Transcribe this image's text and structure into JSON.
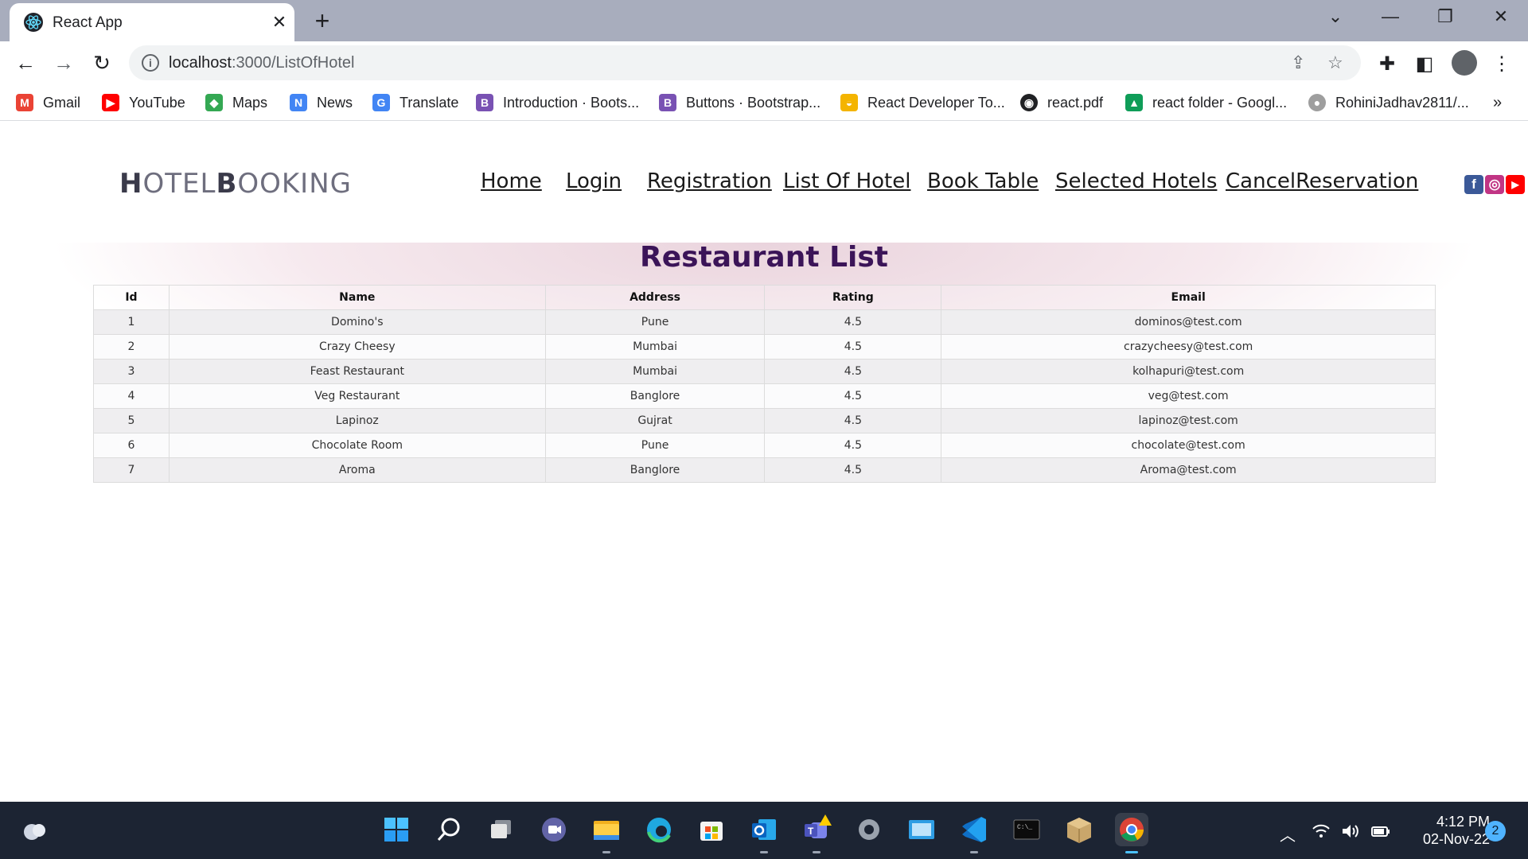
{
  "browser": {
    "tab_title": "React App",
    "tab_close": "✕",
    "new_tab": "+",
    "url_host": "localhost",
    "url_path": ":3000/ListOfHotel",
    "bookmarks": [
      {
        "label": "Gmail",
        "icon": "gmail-icon",
        "color": "#ea4335",
        "glyph": "M"
      },
      {
        "label": "YouTube",
        "icon": "youtube-icon",
        "color": "#ff0000",
        "glyph": "▶"
      },
      {
        "label": "Maps",
        "icon": "maps-icon",
        "color": "#34a853",
        "glyph": "◆"
      },
      {
        "label": "News",
        "icon": "news-icon",
        "color": "#4285f4",
        "glyph": "N"
      },
      {
        "label": "Translate",
        "icon": "translate-icon",
        "color": "#4285f4",
        "glyph": "G"
      },
      {
        "label": "Introduction · Boots...",
        "icon": "bootstrap-icon",
        "color": "#7952b3",
        "glyph": "B"
      },
      {
        "label": "Buttons · Bootstrap...",
        "icon": "bootstrap-icon",
        "color": "#7952b3",
        "glyph": "B"
      },
      {
        "label": "React Developer To...",
        "icon": "chrome-webstore-icon",
        "color": "#f4b400",
        "glyph": "◒"
      },
      {
        "label": "react.pdf",
        "icon": "globe-icon",
        "color": "#202124",
        "glyph": "◉"
      },
      {
        "label": "react folder - Googl...",
        "icon": "google-drive-icon",
        "color": "#0f9d58",
        "glyph": "▲"
      },
      {
        "label": "RohiniJadhav2811/...",
        "icon": "github-icon",
        "color": "#9e9e9e",
        "glyph": "●"
      }
    ],
    "overflow": "»"
  },
  "site": {
    "logo_h": "H",
    "logo_otel": "OTEL",
    "logo_b": "B",
    "logo_ooking": "OOKING",
    "nav": [
      "Home",
      "Login",
      "Registration",
      "List Of Hotel",
      "Book Table",
      "Selected Hotels",
      "CancelReservation"
    ],
    "social": [
      {
        "icon": "facebook-icon",
        "color": "#3b5998",
        "glyph": "f"
      },
      {
        "icon": "instagram-icon",
        "color": "#c13584",
        "glyph": "◎"
      },
      {
        "icon": "youtube-icon",
        "color": "#ff0000",
        "glyph": "▶"
      }
    ]
  },
  "page": {
    "title": "Restaurant List",
    "columns": [
      "Id",
      "Name",
      "Address",
      "Rating",
      "Email"
    ],
    "rows": [
      [
        "1",
        "Domino's",
        "Pune",
        "4.5",
        "dominos@test.com"
      ],
      [
        "2",
        "Crazy Cheesy",
        "Mumbai",
        "4.5",
        "crazycheesy@test.com"
      ],
      [
        "3",
        "Feast Restaurant",
        "Mumbai",
        "4.5",
        "kolhapuri@test.com"
      ],
      [
        "4",
        "Veg Restaurant",
        "Banglore",
        "4.5",
        "veg@test.com"
      ],
      [
        "5",
        "Lapinoz",
        "Gujrat",
        "4.5",
        "lapinoz@test.com"
      ],
      [
        "6",
        "Chocolate Room",
        "Pune",
        "4.5",
        "chocolate@test.com"
      ],
      [
        "7",
        "Aroma",
        "Banglore",
        "4.5",
        "Aroma@test.com"
      ]
    ]
  },
  "taskbar": {
    "time": "4:12 PM",
    "date": "02-Nov-22",
    "notifications": "2"
  },
  "colors": {
    "title": "#3b1458",
    "taskbar": "#1c2433",
    "titlebar": "#a8adbd"
  }
}
